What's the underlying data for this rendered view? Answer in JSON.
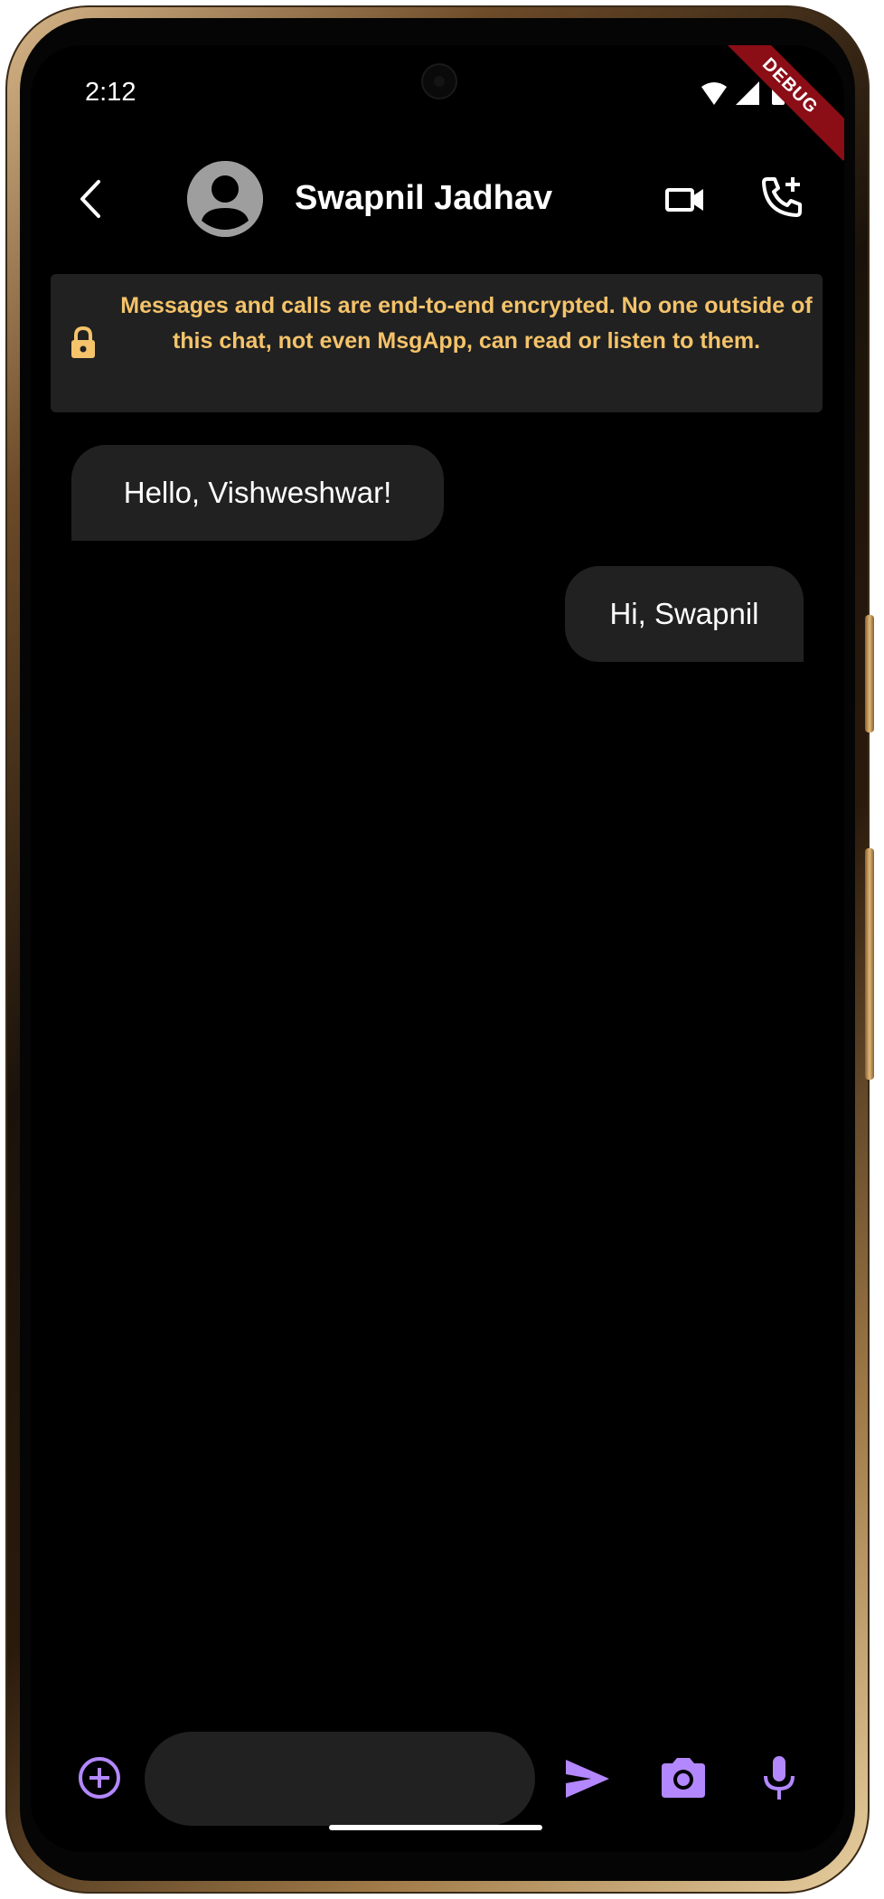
{
  "status_bar": {
    "time": "2:12",
    "debug_label": "DEBUG",
    "icons": [
      "wifi-icon",
      "signal-icon",
      "battery-icon"
    ]
  },
  "header": {
    "back_icon": "chevron-left-icon",
    "avatar_icon": "account-circle-icon",
    "contact_name": "Swapnil Jadhav",
    "video_call_icon": "videocam-icon",
    "add_call_icon": "add-call-icon"
  },
  "encryption_notice": {
    "icon": "lock-icon",
    "text": "Messages and calls are end-to-end encrypted. No one outside of this chat, not even MsgApp, can read or listen to them."
  },
  "messages": [
    {
      "direction": "incoming",
      "text": "Hello, Vishweshwar!"
    },
    {
      "direction": "outgoing",
      "text": "Hi, Swapnil"
    }
  ],
  "composer": {
    "add_icon": "add-circle-icon",
    "input_value": "",
    "send_icon": "send-icon",
    "camera_icon": "camera-icon",
    "mic_icon": "mic-icon"
  },
  "colors": {
    "background": "#000000",
    "bubble": "#212121",
    "notice_text": "#f4c36a",
    "accent": "#b388ff",
    "debug_ribbon": "#8b0d16"
  }
}
